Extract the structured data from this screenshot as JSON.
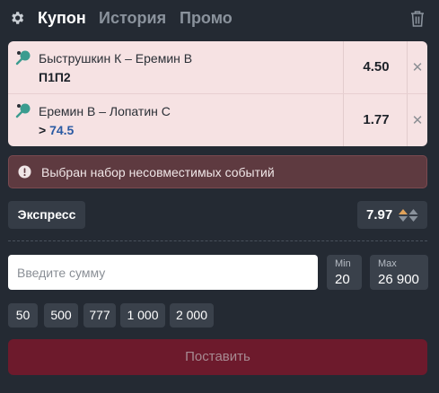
{
  "header": {
    "tabs": [
      {
        "label": "Купон",
        "active": true
      },
      {
        "label": "История",
        "active": false
      },
      {
        "label": "Промо",
        "active": false
      }
    ],
    "icons": {
      "settings": "gear-icon",
      "delete": "trash-icon"
    }
  },
  "bets": [
    {
      "sport_icon": "table-tennis-icon",
      "event": "Быструшкин К – Еремин В",
      "pick_label": "П1П2",
      "odds": "4.50"
    },
    {
      "sport_icon": "table-tennis-icon",
      "event": "Еремин В – Лопатин С",
      "pick_prefix": ">",
      "pick_value": "74.5",
      "odds": "1.77"
    }
  ],
  "warning": {
    "text": "Выбран набор несовместимых событий",
    "icon": "exclamation-icon"
  },
  "bet_type": {
    "label": "Экспресс"
  },
  "total_odds": {
    "value": "7.97"
  },
  "stake": {
    "placeholder": "Введите сумму",
    "min_label": "Min",
    "min_value": "20",
    "max_label": "Max",
    "max_value": "26 900"
  },
  "quick_amounts": [
    "50",
    "500",
    "777",
    "1 000",
    "2 000"
  ],
  "submit": {
    "label": "Поставить"
  },
  "colors": {
    "background": "#242a33",
    "bet_card": "#f6e2e3",
    "warning_bg": "#5e3a40",
    "submit_bg": "#6d1a2c",
    "pick_value": "#2a5aa3",
    "arrow_up": "#e0a25a"
  }
}
